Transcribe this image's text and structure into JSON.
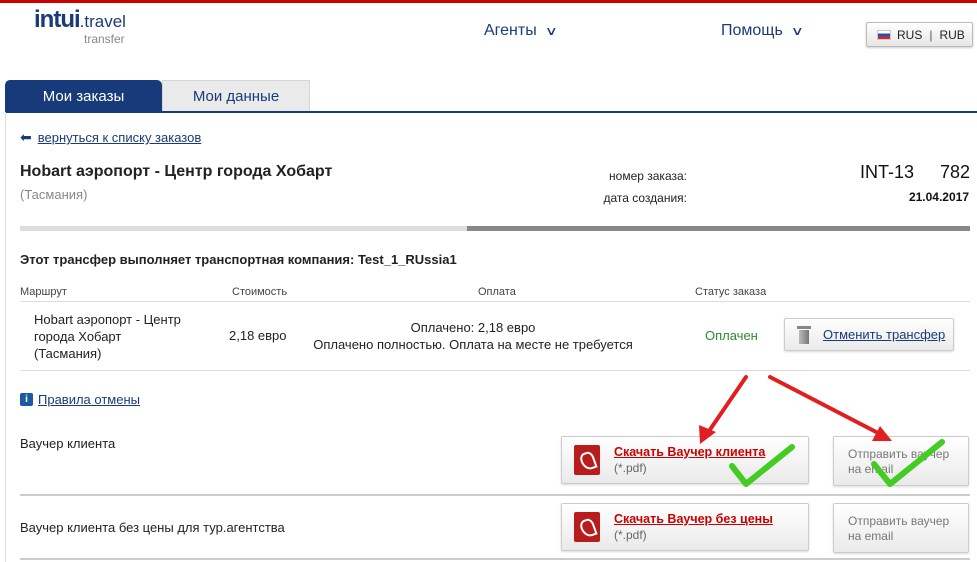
{
  "header": {
    "logo_brand": "intui",
    "logo_travel": ".travel",
    "logo_sub": "transfer",
    "nav_agents": "Агенты",
    "nav_help": "Помощь",
    "lang": "RUS",
    "currency": "RUB",
    "lang_separator": "|"
  },
  "tabs": {
    "active": "Мои заказы",
    "inactive": "Мои данные"
  },
  "order": {
    "back_link": "вернуться к списку заказов",
    "title": "Hobart аэропорт - Центр города Хобарт",
    "region": "(Тасмания)",
    "number_label": "номер заказа:",
    "number_prefix": "INT-13",
    "number_suffix": "782",
    "date_label": "дата создания:",
    "date": "21.04.2017",
    "progress": 0.47,
    "carrier_text": "Этот трансфер выполняет транспортная компания: Test_1_RUssia1"
  },
  "table": {
    "headers": [
      "Маршрут",
      "Стоимость",
      "Оплата",
      "Статус заказа"
    ],
    "route_line1": "Hobart аэропорт - Центр",
    "route_line2": "города Хобарт",
    "route_line3": "(Тасмания)",
    "price": "2,18 евро",
    "payment_line1": "Оплачено: 2,18 евро",
    "payment_line2": "Оплачено полностью. Оплата на месте не требуется",
    "status": "Оплачен",
    "cancel_button": "Отменить трансфер"
  },
  "rules_link": "Правила отмены",
  "vouchers": [
    {
      "label": "Ваучер клиента",
      "download": "Скачать Ваучер клиента",
      "format": "(*.pdf)",
      "email_line1": "Отправить ваучер",
      "email_line2": "на email"
    },
    {
      "label": "Ваучер клиента без цены для тур.агентства",
      "download": "Скачать Ваучер без цены",
      "format": "(*.pdf)",
      "email_line1": "Отправить ваучер",
      "email_line2": "на email"
    }
  ],
  "colors": {
    "accent": "#163a7a",
    "status_paid": "#2c8a2c",
    "download_red": "#cc0000",
    "annotation_arrow": "#e02020",
    "annotation_check": "#44cc22"
  },
  "icons": [
    "back-arrow-icon",
    "flag-ru-icon",
    "chevron-down-icon",
    "trash-icon",
    "info-icon",
    "pdf-icon"
  ]
}
